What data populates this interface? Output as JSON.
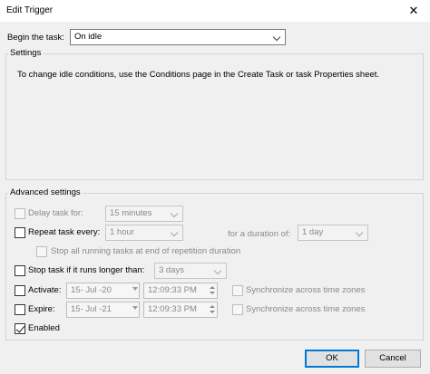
{
  "window": {
    "title": "Edit Trigger",
    "close_glyph": "✕"
  },
  "begin": {
    "label": "Begin the task:",
    "value": "On idle"
  },
  "settings": {
    "legend": "Settings",
    "message": "To change idle conditions, use the Conditions page in the Create Task or task Properties sheet."
  },
  "advanced": {
    "legend": "Advanced settings",
    "delay": {
      "label": "Delay task for:",
      "value": "15 minutes",
      "checked": false
    },
    "repeat": {
      "label": "Repeat task every:",
      "value": "1 hour",
      "checked": false,
      "duration_label": "for a duration of:",
      "duration_value": "1 day",
      "stop_all_label": "Stop all running tasks at end of repetition duration"
    },
    "stop": {
      "label": "Stop task if it runs longer than:",
      "value": "3 days",
      "checked": false
    },
    "activate": {
      "label": "Activate:",
      "date": "15- Jul -20",
      "time": "12:09:33 PM",
      "sync_label": "Synchronize across time zones",
      "checked": false
    },
    "expire": {
      "label": "Expire:",
      "date": "15- Jul -21",
      "time": "12:09:33 PM",
      "sync_label": "Synchronize across time zones",
      "checked": false
    },
    "enabled": {
      "label": "Enabled",
      "checked": true
    }
  },
  "buttons": {
    "ok": "OK",
    "cancel": "Cancel"
  },
  "colors": {
    "window_bg": "#f0f0f0",
    "default_button_border": "#0078d7"
  }
}
